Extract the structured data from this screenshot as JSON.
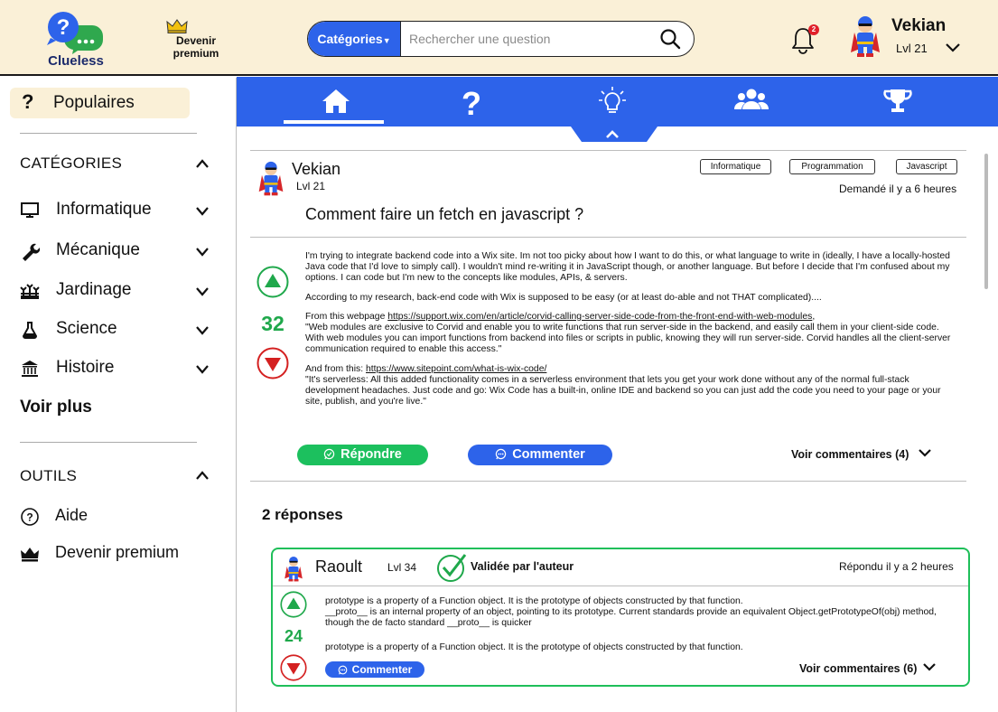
{
  "header": {
    "logo_text": "Clueless",
    "premium_label_1": "Devenir",
    "premium_label_2": "premium",
    "search": {
      "category_button": "Catégories",
      "placeholder": "Rechercher une question"
    },
    "notifications_count": "2",
    "user": {
      "name": "Vekian",
      "level": "Lvl 21"
    }
  },
  "sidebar": {
    "popular_label": "Populaires",
    "categories_title": "CATÉGORIES",
    "categories": [
      {
        "label": "Informatique",
        "icon": "monitor-icon"
      },
      {
        "label": "Mécanique",
        "icon": "wrench-icon"
      },
      {
        "label": "Jardinage",
        "icon": "garden-icon"
      },
      {
        "label": "Science",
        "icon": "flask-icon"
      },
      {
        "label": "Histoire",
        "icon": "monument-icon"
      }
    ],
    "see_more": "Voir plus",
    "tools_title": "OUTILS",
    "tools": [
      {
        "label": "Aide",
        "icon": "help-icon"
      },
      {
        "label": "Devenir premium",
        "icon": "crown-icon"
      }
    ]
  },
  "nav": {
    "tabs": [
      "home-icon",
      "question-icon",
      "lightbulb-icon",
      "users-icon",
      "trophy-icon"
    ],
    "active": "home-icon"
  },
  "question": {
    "author": "Vekian",
    "level": "Lvl 21",
    "title": "Comment faire un fetch en javascript ?",
    "tags": [
      "Informatique",
      "Programmation",
      "Javascript"
    ],
    "asked": "Demandé il y a 6 heures",
    "votes": "32",
    "body": {
      "p1": "I'm trying to integrate backend code into a Wix site. Im not too picky about how I want to do this, or what language to write in (ideally, I have a locally-hosted Java code that I'd love to simply call). I wouldn't mind re-writing it in JavaScript though, or another language. But before I decide that I'm confused about my options. I can code but I'm new to the concepts like modules, APIs, & servers.",
      "p2": "According to my research, back-end code with Wix is supposed to be easy (or at least do-able and not THAT complicated)....",
      "p3_intro": "From this webpage ",
      "p3_link": "https://support.wix.com/en/article/corvid-calling-server-side-code-from-the-front-end-with-web-modules",
      "p3_after": ",",
      "p3_quote": "\"Web modules are exclusive to Corvid and enable you to write functions that run server-side in the backend, and easily call them in your client-side code. With web modules you can import functions from backend into files or scripts in public, knowing they will run server-side. Corvid handles all the client-server communication required to enable this access.\"",
      "p4_intro": "And from this: ",
      "p4_link": "https://www.sitepoint.com/what-is-wix-code/",
      "p4_quote": "\"It's serverless: All this added functionality comes in a serverless environment that lets you get your work done without any of the normal full-stack development headaches. Just code and go: Wix Code has a built-in, online IDE and backend so you can just add the code you need to your page or your site, publish, and you're live.\""
    },
    "reply_button": "Répondre",
    "comment_button": "Commenter",
    "see_comments": "Voir commentaires (4)"
  },
  "answers": {
    "title": "2 réponses",
    "items": [
      {
        "author": "Raoult",
        "level": "Lvl 34",
        "validated": "Validée par l'auteur",
        "time": "Répondu il y a 2 heures",
        "votes": "24",
        "p1": "prototype is a property of a Function object. It is the prototype of objects constructed by that function.",
        "p2": "__proto__ is an internal property of an object, pointing to its prototype. Current standards provide an equivalent Object.getPrototypeOf(obj) method, though the de facto standard __proto__ is quicker",
        "p3": "prototype is a property of a Function object. It is the prototype of objects constructed by that function.",
        "comment_button": "Commenter",
        "see_comments": "Voir commentaires (6)"
      }
    ]
  },
  "colors": {
    "header_bg": "#faf0d7",
    "accent_blue": "#2d63ea",
    "green": "#1cc05e",
    "red": "#d42020"
  }
}
